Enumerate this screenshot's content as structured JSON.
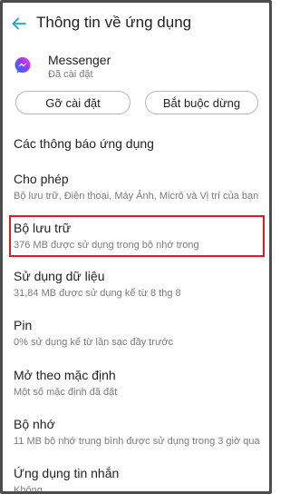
{
  "header": {
    "back_icon": "back-arrow-icon",
    "title": "Thông tin về ứng dụng"
  },
  "app": {
    "icon": "messenger-icon",
    "name": "Messenger",
    "status": "Đã cài đặt"
  },
  "buttons": {
    "uninstall": "Gỡ cài đặt",
    "force_stop": "Bắt buộc dừng"
  },
  "items": [
    {
      "title": "Các thông báo ứng dụng",
      "subtitle": ""
    },
    {
      "title": "Cho phép",
      "subtitle": "Bộ lưu trữ, Điện thoại, Máy Ảnh, Micrô và Vị trí của bạn"
    },
    {
      "title": "Bộ lưu trữ",
      "subtitle": "376 MB được sử dụng trong bộ nhớ trong"
    },
    {
      "title": "Sử dụng dữ liệu",
      "subtitle": "31,84 MB được sử dụng kể từ 8 thg 8"
    },
    {
      "title": "Pin",
      "subtitle": "0% sử dụng kể từ lần sạc đầy trước"
    },
    {
      "title": "Mở theo mặc định",
      "subtitle": "Một số mặc định đã đặt"
    },
    {
      "title": "Bộ nhớ",
      "subtitle": "11 MB bộ nhớ trung bình được sử dụng trong 3 giờ qua"
    },
    {
      "title": "Ứng dụng tin nhắn",
      "subtitle": "Không"
    }
  ],
  "colors": {
    "accent": "#1ea2c9",
    "highlight_border": "#e01b24"
  }
}
